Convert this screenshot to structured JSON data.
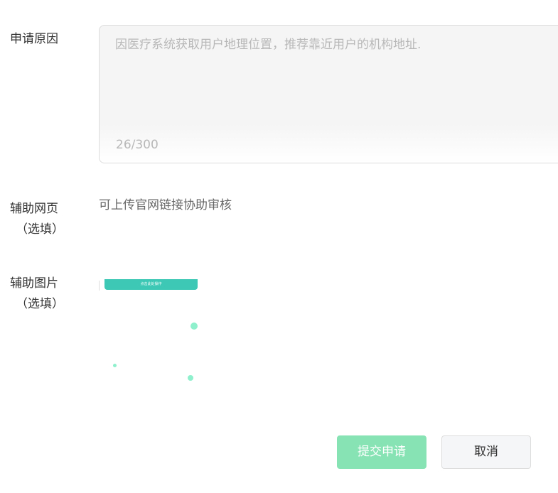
{
  "form": {
    "reason": {
      "label": "申请原因",
      "value": "因医疗系统获取用户地理位置，推荐靠近用户的机构地址.",
      "counter": "26/300"
    },
    "web": {
      "label": "辅助网页",
      "optional": "（选填）",
      "hint": "可上传官网链接协助审核"
    },
    "image": {
      "label": "辅助图片",
      "optional": "（选填）",
      "thumbnail_text": "点击此处操作"
    }
  },
  "actions": {
    "submit_label": "提交申请",
    "cancel_label": "取消"
  },
  "colors": {
    "submit_bg": "#87e3b4",
    "thumbnail_bg": "#3cc8b4",
    "dot": "#8ef0cc"
  }
}
